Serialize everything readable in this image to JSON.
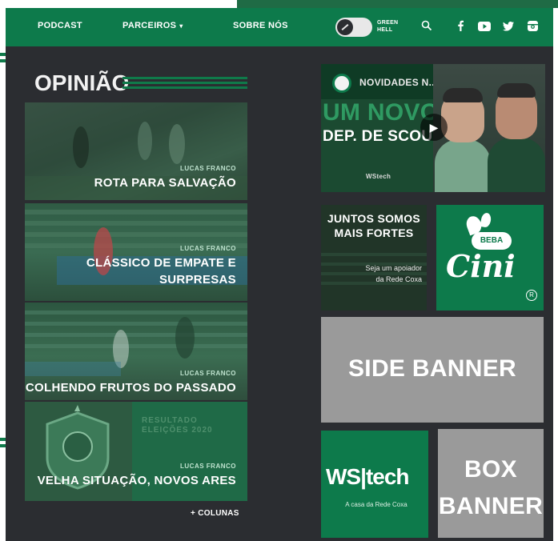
{
  "nav": {
    "links": [
      "PODCAST",
      "PARCEIROS",
      "SOBRE NÓS"
    ],
    "parceiros_caret": "▾",
    "toggle_label": "GREEN HELL"
  },
  "opiniao": {
    "title": "OPINIÃO",
    "cards": [
      {
        "author": "LUCAS FRANCO",
        "title": "ROTA PARA SALVAÇÃO"
      },
      {
        "author": "LUCAS FRANCO",
        "title": "CLÁSSICO DE EMPATE E SURPRESAS"
      },
      {
        "author": "LUCAS FRANCO",
        "title": "COLHENDO FRUTOS DO PASSADO"
      },
      {
        "author": "LUCAS FRANCO",
        "title": "VELHA SITUAÇÃO, NOVOS ARES",
        "overlay": "RESULTADO ELEIÇÕES 2020"
      }
    ],
    "more_link": "+ COLUNAS"
  },
  "video": {
    "title": "NOVIDADES N...",
    "headline_1": "UM NOVO",
    "headline_2": "DEP. DE SCOUT",
    "sponsors": "WStech"
  },
  "juntos": {
    "title": "JUNTOS SOMOS MAIS FORTES",
    "body": "Seja um apoiador da Rede Coxa"
  },
  "cini": {
    "beba": "BEBA",
    "word": "Cini",
    "reg": "R"
  },
  "side_banner": "SIDE BANNER",
  "wstech": {
    "logo": "WS|tech",
    "sub": "A casa da Rede Coxa"
  },
  "box_banner": "BOX BANNER"
}
